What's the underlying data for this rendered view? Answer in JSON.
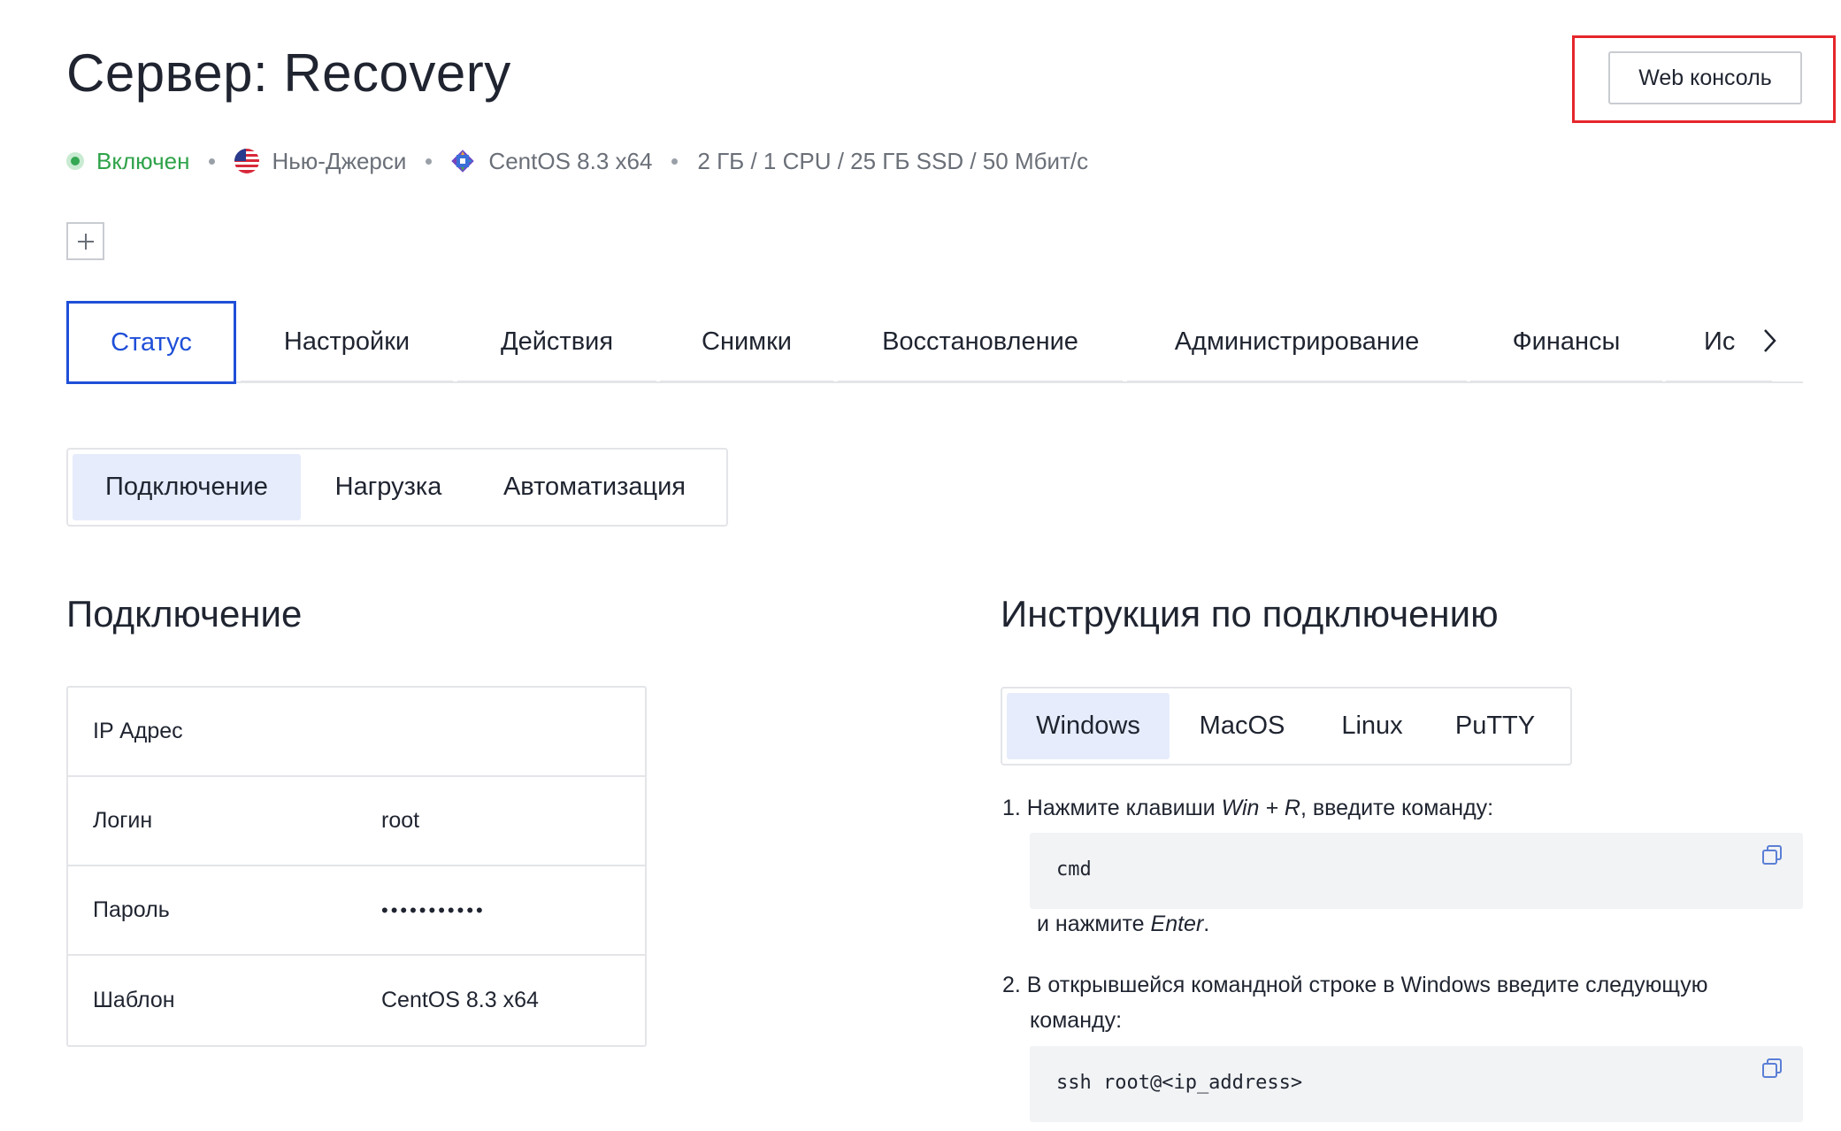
{
  "header": {
    "title": "Сервер: Recovery",
    "web_console_label": "Web консоль"
  },
  "meta": {
    "status": "Включен",
    "location": "Нью-Джерси",
    "os": "CentOS 8.3 x64",
    "specs": "2 ГБ / 1 CPU / 25 ГБ SSD / 50 Мбит/с",
    "status_color": "#2fa34a"
  },
  "plus_label": "+",
  "tabs": [
    {
      "label": "Статус"
    },
    {
      "label": "Настройки"
    },
    {
      "label": "Действия"
    },
    {
      "label": "Снимки"
    },
    {
      "label": "Восстановление"
    },
    {
      "label": "Администрирование"
    },
    {
      "label": "Финансы"
    },
    {
      "label": "Ис"
    }
  ],
  "subtabs": [
    {
      "label": "Подключение"
    },
    {
      "label": "Нагрузка"
    },
    {
      "label": "Автоматизация"
    }
  ],
  "connection": {
    "heading": "Подключение",
    "rows": [
      {
        "key": "IP Адрес",
        "value": ""
      },
      {
        "key": "Логин",
        "value": "root"
      },
      {
        "key": "Пароль",
        "value": "•••••••••••"
      },
      {
        "key": "Шаблон",
        "value": "CentOS 8.3 x64"
      }
    ]
  },
  "instructions": {
    "heading": "Инструкция по подключению",
    "os_tabs": [
      {
        "label": "Windows"
      },
      {
        "label": "MacOS"
      },
      {
        "label": "Linux"
      },
      {
        "label": "PuTTY"
      }
    ],
    "step1_prefix": "1. Нажмите клавиши ",
    "step1_keys": "Win + R",
    "step1_suffix": ", введите команду:",
    "step1_code": "cmd",
    "step1_after_prefix": "и нажмите ",
    "step1_after_key": "Enter",
    "step1_after_suffix": ".",
    "step2_line1": "2. В открывшейся командной строке в Windows введите следующую",
    "step2_line2": "команду:",
    "step2_code": "ssh root@<ip_address>"
  },
  "colors": {
    "accent": "#1f4fd8",
    "active_segment_bg": "#e6ecfb",
    "highlight_border": "#e5262b"
  }
}
